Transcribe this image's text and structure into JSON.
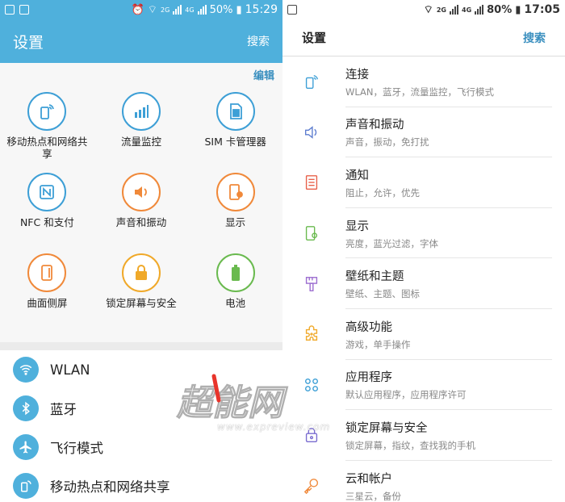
{
  "left": {
    "status": {
      "battery": "50%",
      "time": "15:29",
      "net": "4G",
      "net2": "2G"
    },
    "header": {
      "title": "设置",
      "search": "搜索"
    },
    "edit": "编辑",
    "grid": [
      {
        "label": "移动热点和网络共享",
        "icon": "hotspot-icon",
        "color": "#3d9fd6"
      },
      {
        "label": "流量监控",
        "icon": "data-usage-icon",
        "color": "#3d9fd6"
      },
      {
        "label": "SIM 卡管理器",
        "icon": "sim-card-icon",
        "color": "#3d9fd6"
      },
      {
        "label": "NFC 和支付",
        "icon": "nfc-icon",
        "color": "#3d9fd6"
      },
      {
        "label": "声音和振动",
        "icon": "speaker-icon",
        "color": "#f0893a"
      },
      {
        "label": "显示",
        "icon": "display-icon",
        "color": "#f0893a"
      },
      {
        "label": "曲面侧屏",
        "icon": "edge-screen-icon",
        "color": "#f0893a"
      },
      {
        "label": "锁定屏幕与安全",
        "icon": "lock-icon",
        "color": "#f0a92a"
      },
      {
        "label": "电池",
        "icon": "battery-icon",
        "color": "#6aba4f"
      }
    ],
    "list": [
      {
        "label": "WLAN",
        "icon": "wifi-icon"
      },
      {
        "label": "蓝牙",
        "icon": "bluetooth-icon"
      },
      {
        "label": "飞行模式",
        "icon": "airplane-icon"
      },
      {
        "label": "移动热点和网络共享",
        "icon": "hotspot-icon"
      }
    ]
  },
  "right": {
    "status": {
      "battery": "80%",
      "time": "17:05",
      "net": "4G",
      "net2": "2G"
    },
    "header": {
      "title": "设置",
      "search": "搜索"
    },
    "items": [
      {
        "title": "连接",
        "sub": "WLAN，蓝牙，流量监控，飞行模式",
        "icon": "connections-icon",
        "color": "#3d9fd6"
      },
      {
        "title": "声音和振动",
        "sub": "声音，振动，免打扰",
        "icon": "speaker-icon",
        "color": "#5c7ccf"
      },
      {
        "title": "通知",
        "sub": "阻止，允许，优先",
        "icon": "notification-icon",
        "color": "#e8604a"
      },
      {
        "title": "显示",
        "sub": "亮度，蓝光过滤，字体",
        "icon": "display-icon",
        "color": "#6aba4f"
      },
      {
        "title": "壁纸和主题",
        "sub": "壁纸、主题、图标",
        "icon": "brush-icon",
        "color": "#9b6cd0"
      },
      {
        "title": "高级功能",
        "sub": "游戏，单手操作",
        "icon": "puzzle-icon",
        "color": "#f0a92a"
      },
      {
        "title": "应用程序",
        "sub": "默认应用程序，应用程序许可",
        "icon": "apps-icon",
        "color": "#3d9fd6"
      },
      {
        "title": "锁定屏幕与安全",
        "sub": "锁定屏幕，指纹，查找我的手机",
        "icon": "lock-icon",
        "color": "#7a6cd0"
      },
      {
        "title": "云和帐户",
        "sub": "三星云，备份",
        "icon": "key-icon",
        "color": "#f0893a"
      }
    ]
  },
  "watermark": {
    "url": "www.expreview.com"
  }
}
